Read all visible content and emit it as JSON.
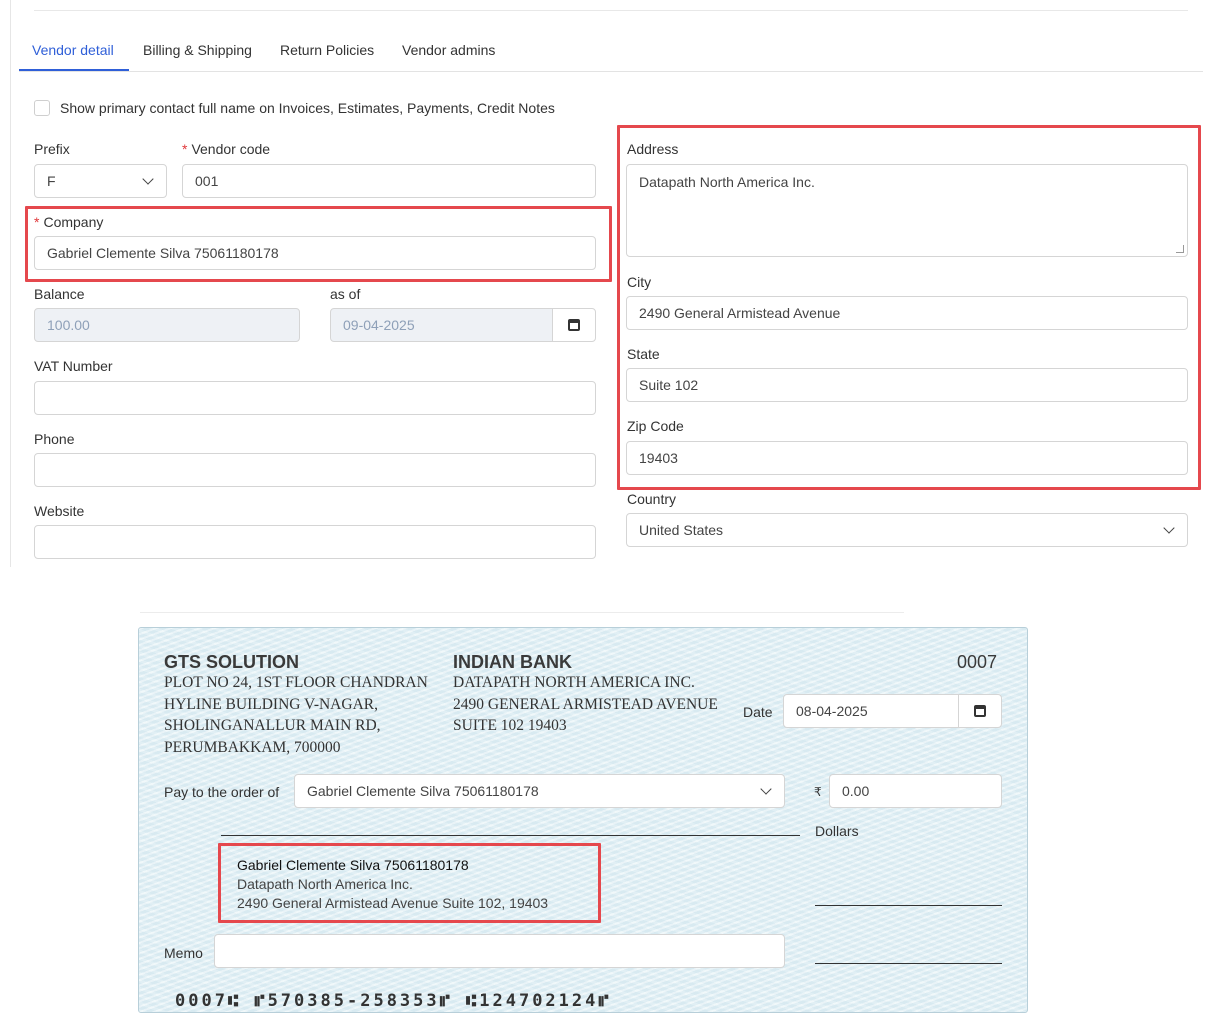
{
  "tabs": [
    {
      "label": "Vendor detail",
      "active": true
    },
    {
      "label": "Billing & Shipping",
      "active": false
    },
    {
      "label": "Return Policies",
      "active": false
    },
    {
      "label": "Vendor admins",
      "active": false
    }
  ],
  "show_contact": {
    "label": "Show primary contact full name on Invoices, Estimates, Payments, Credit Notes",
    "checked": false
  },
  "prefix": {
    "label": "Prefix",
    "value": "F"
  },
  "vendor_code": {
    "label": "Vendor code",
    "value": "001"
  },
  "company": {
    "label": "Company",
    "value": "Gabriel Clemente Silva 75061180178"
  },
  "balance": {
    "label": "Balance",
    "value": "100.00"
  },
  "as_of": {
    "label": "as of",
    "value": "09-04-2025"
  },
  "vat": {
    "label": "VAT Number",
    "value": ""
  },
  "phone": {
    "label": "Phone",
    "value": ""
  },
  "website": {
    "label": "Website",
    "value": ""
  },
  "address": {
    "label": "Address",
    "value": "Datapath North America Inc."
  },
  "city": {
    "label": "City",
    "value": "2490 General Armistead Avenue"
  },
  "state": {
    "label": "State",
    "value": "Suite 102"
  },
  "zip": {
    "label": "Zip Code",
    "value": "19403"
  },
  "country": {
    "label": "Country",
    "value": "United States"
  },
  "required_mark": "*",
  "cheque": {
    "company_name": "GTS SOLUTION",
    "company_lines": [
      "PLOT NO 24, 1ST FLOOR CHANDRAN",
      "HYLINE BUILDING V-NAGAR,",
      "SHOLINGANALLUR MAIN RD,",
      "PERUMBAKKAM, 700000"
    ],
    "bank_name": "INDIAN BANK",
    "bank_lines": [
      "DATAPATH NORTH AMERICA INC.",
      "2490 GENERAL ARMISTEAD AVENUE",
      "SUITE 102 19403"
    ],
    "number": "0007",
    "date_label": "Date",
    "date_value": "08-04-2025",
    "pay_to_label": "Pay to the order of",
    "pay_to_value": "Gabriel Clemente Silva 75061180178",
    "currency_symbol": "₹",
    "amount": "0.00",
    "dollars_label": "Dollars",
    "payee_name": "Gabriel Clemente Silva 75061180178",
    "payee_line1": "Datapath North America Inc.",
    "payee_line2": "2490 General Armistead Avenue Suite 102, 19403",
    "memo_label": "Memo",
    "memo_value": "",
    "micr": "0007⑆ ⑈570385-258353⑈ ⑆124702124⑈"
  },
  "colors": {
    "accent": "#2f5fd8",
    "highlight": "#e5484d",
    "required": "#e0383b",
    "cheque_bg": "#e4f2f6"
  }
}
